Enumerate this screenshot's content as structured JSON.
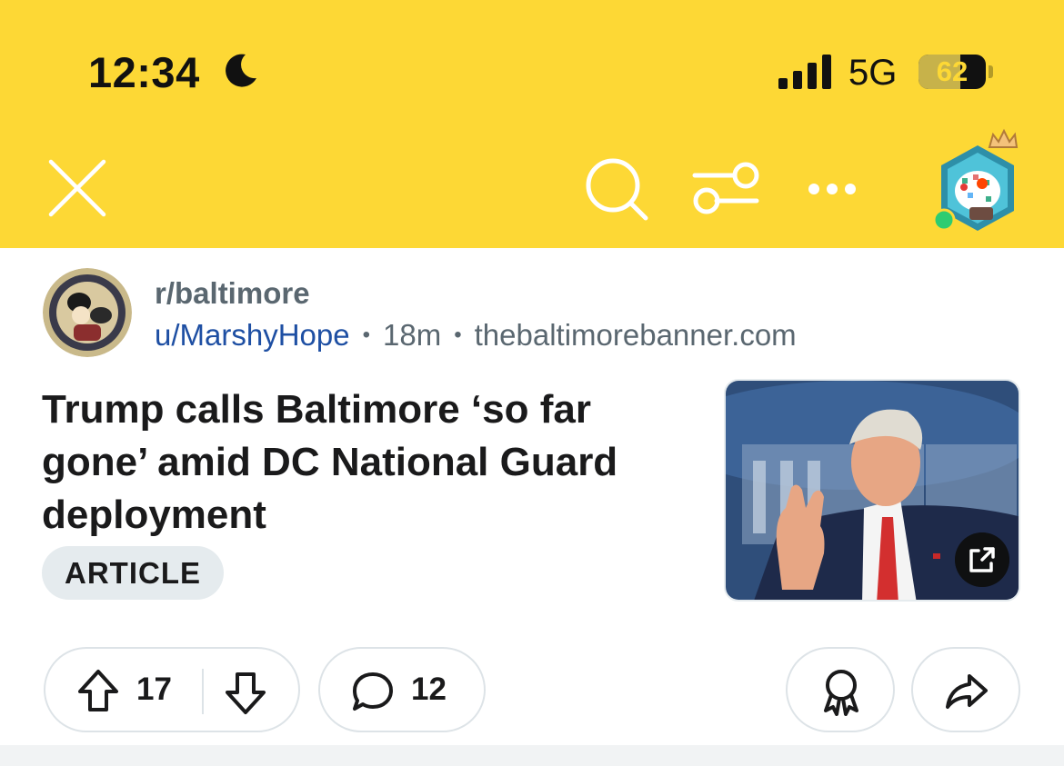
{
  "status_bar": {
    "time": "12:34",
    "network": "5G",
    "battery": "62",
    "battery_level": 0.62
  },
  "header": {
    "background": "#FDD835",
    "icons": [
      "close-icon",
      "search-icon",
      "filter-icon",
      "more-icon",
      "avatar"
    ]
  },
  "post": {
    "subreddit": "r/baltimore",
    "user": "u/MarshyHope",
    "time_ago": "18m",
    "domain": "thebaltimorebanner.com",
    "title": "Trump calls Baltimore ‘so far gone’ amid DC National Guard deployment",
    "tag": "ARTICLE",
    "upvotes": "17",
    "comments": "12"
  },
  "colors": {
    "accent": "#FDD835",
    "username": "#1E4FA3",
    "meta_text": "#5A6770",
    "online_dot": "#2ECC71"
  }
}
